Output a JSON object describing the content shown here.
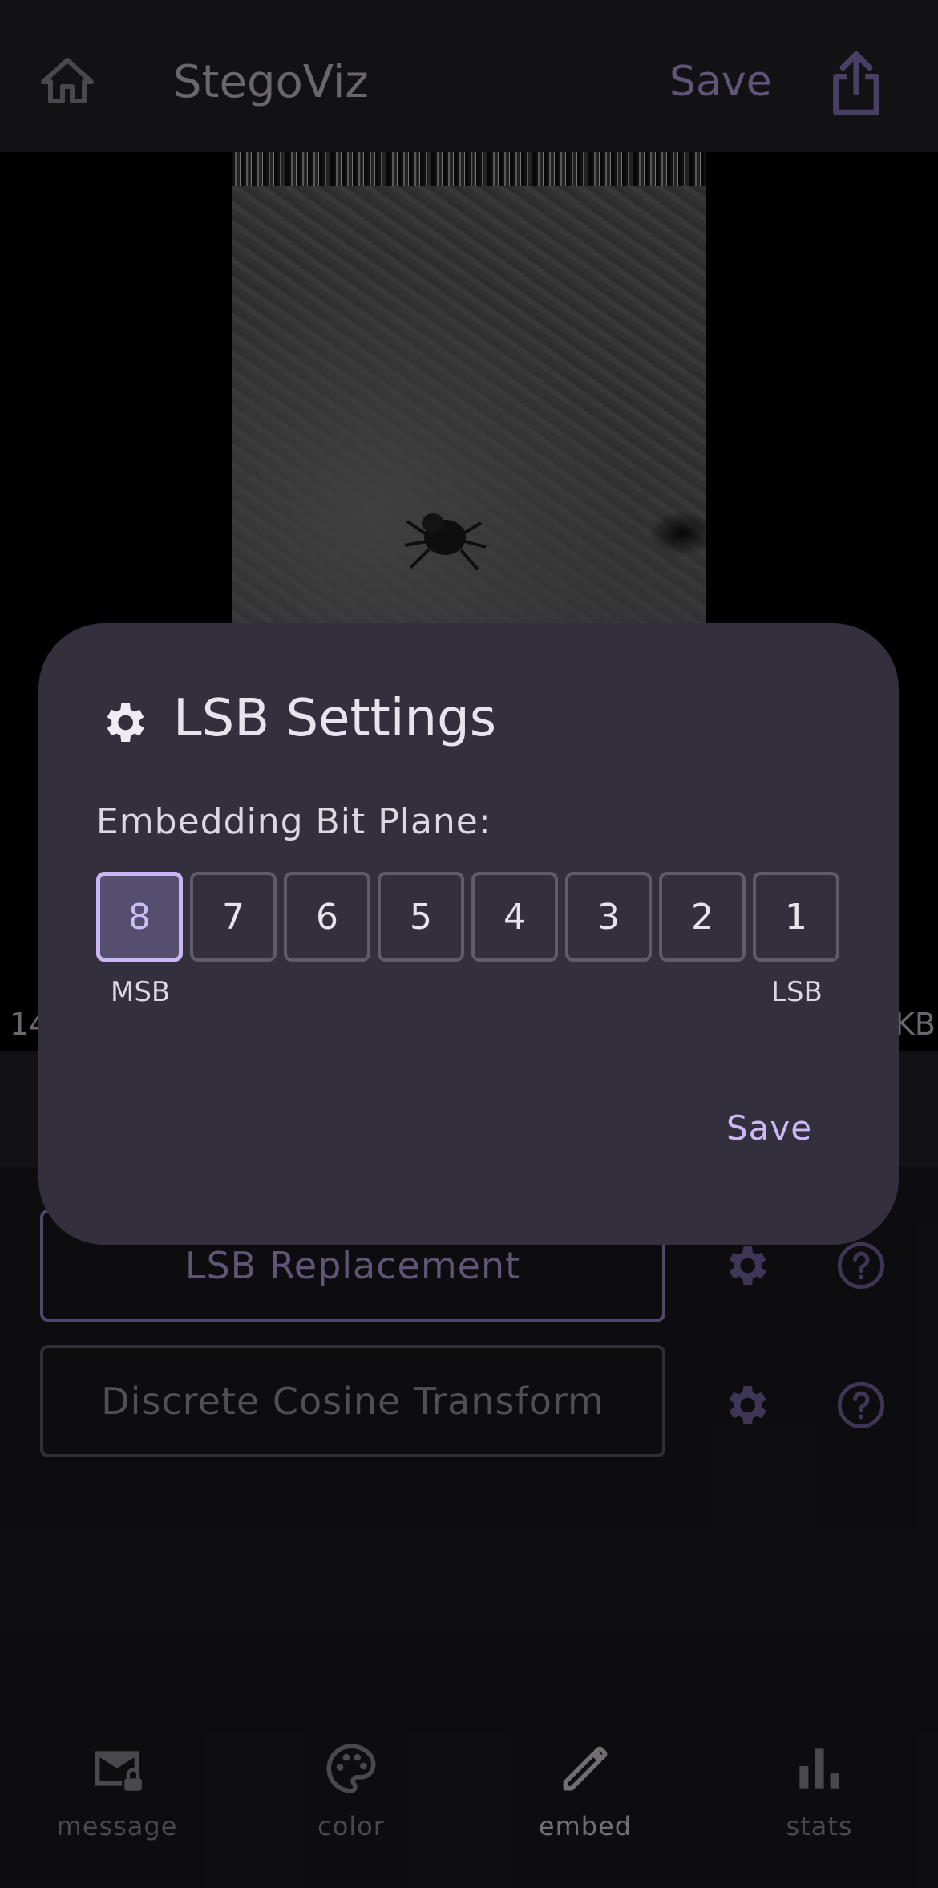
{
  "app": {
    "title": "StegoViz",
    "save_label": "Save"
  },
  "image_info": {
    "size_left": "14",
    "size_right": "KB"
  },
  "methods": [
    {
      "label": "LSB Replacement",
      "selected": true
    },
    {
      "label": "Discrete Cosine Transform",
      "selected": false
    }
  ],
  "nav": [
    {
      "label": "message",
      "icon": "mail-lock-icon",
      "active": false
    },
    {
      "label": "color",
      "icon": "palette-icon",
      "active": false
    },
    {
      "label": "embed",
      "icon": "pencil-icon",
      "active": true
    },
    {
      "label": "stats",
      "icon": "bar-chart-icon",
      "active": false
    }
  ],
  "dialog": {
    "title": "LSB Settings",
    "subtitle": "Embedding Bit Plane:",
    "bits": [
      "8",
      "7",
      "6",
      "5",
      "4",
      "3",
      "2",
      "1"
    ],
    "selected_bit": "8",
    "msb_label": "MSB",
    "lsb_label": "LSB",
    "save_label": "Save"
  },
  "colors": {
    "accent": "#b7a3e6",
    "surface": "#332f3c",
    "background": "#1a1a1f"
  }
}
